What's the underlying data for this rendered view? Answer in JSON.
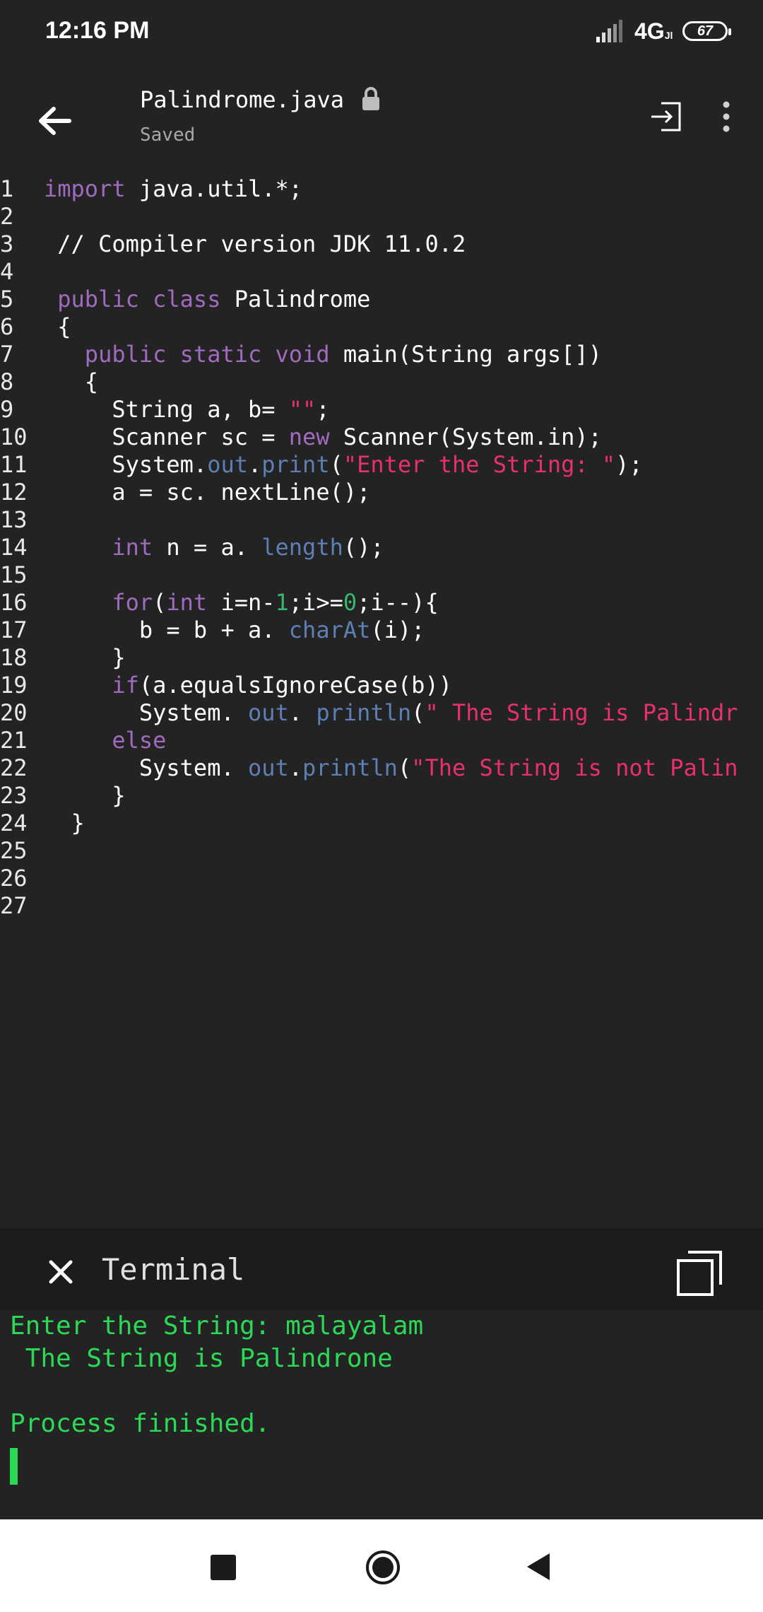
{
  "status_bar": {
    "time": "12:16 PM",
    "network": "4G",
    "network_sub": "Jl",
    "battery": "67"
  },
  "app_bar": {
    "title": "Palindrome.java",
    "subtitle": "Saved",
    "icons": [
      "back-arrow-icon",
      "lock-icon",
      "run-icon",
      "more-vert-icon"
    ]
  },
  "editor": {
    "line_numbers": [
      "1",
      "2",
      "3",
      "4",
      "5",
      "6",
      "7",
      "8",
      "9",
      "10",
      "11",
      "12",
      "13",
      "14",
      "15",
      "16",
      "17",
      "18",
      "19",
      "20",
      "21",
      "22",
      "23",
      "24",
      "25",
      "26",
      "27"
    ],
    "lines": [
      [
        {
          "t": "import",
          "c": "kw"
        },
        {
          "t": " java.util.*;"
        }
      ],
      [],
      [
        {
          "t": " // Compiler version JDK 11.0.2"
        }
      ],
      [],
      [
        {
          "t": " "
        },
        {
          "t": "public class",
          "c": "kw"
        },
        {
          "t": " Palindrome"
        }
      ],
      [
        {
          "t": " {"
        }
      ],
      [
        {
          "t": "   "
        },
        {
          "t": "public static void",
          "c": "kw"
        },
        {
          "t": " main(String args[])"
        }
      ],
      [
        {
          "t": "   {"
        }
      ],
      [
        {
          "t": "     String a, b= "
        },
        {
          "t": "\"\"",
          "c": "str"
        },
        {
          "t": ";"
        }
      ],
      [
        {
          "t": "     Scanner sc = "
        },
        {
          "t": "new",
          "c": "kw"
        },
        {
          "t": " Scanner(System.in);"
        }
      ],
      [
        {
          "t": "     System."
        },
        {
          "t": "out",
          "c": "fn"
        },
        {
          "t": "."
        },
        {
          "t": "print",
          "c": "fn"
        },
        {
          "t": "("
        },
        {
          "t": "\"Enter the String: \"",
          "c": "str"
        },
        {
          "t": ");"
        }
      ],
      [
        {
          "t": "     a = sc. nextLine();"
        }
      ],
      [],
      [
        {
          "t": "     "
        },
        {
          "t": "int",
          "c": "kw"
        },
        {
          "t": " n = a. "
        },
        {
          "t": "length",
          "c": "fn"
        },
        {
          "t": "();"
        }
      ],
      [],
      [
        {
          "t": "     "
        },
        {
          "t": "for",
          "c": "kw"
        },
        {
          "t": "("
        },
        {
          "t": "int",
          "c": "kw"
        },
        {
          "t": " i=n-"
        },
        {
          "t": "1",
          "c": "num"
        },
        {
          "t": ";i>="
        },
        {
          "t": "0",
          "c": "num"
        },
        {
          "t": ";i--){"
        }
      ],
      [
        {
          "t": "       b = b + a. "
        },
        {
          "t": "charAt",
          "c": "fn"
        },
        {
          "t": "(i);"
        }
      ],
      [
        {
          "t": "     }"
        }
      ],
      [
        {
          "t": "     "
        },
        {
          "t": "if",
          "c": "kw"
        },
        {
          "t": "(a.equalsIgnoreCase(b))"
        }
      ],
      [
        {
          "t": "       System. "
        },
        {
          "t": "out",
          "c": "fn"
        },
        {
          "t": ". "
        },
        {
          "t": "println",
          "c": "fn"
        },
        {
          "t": "("
        },
        {
          "t": "\" The String is Palindr",
          "c": "str"
        }
      ],
      [
        {
          "t": "     "
        },
        {
          "t": "else",
          "c": "kw"
        }
      ],
      [
        {
          "t": "       System. "
        },
        {
          "t": "out",
          "c": "fn"
        },
        {
          "t": "."
        },
        {
          "t": "println",
          "c": "fn"
        },
        {
          "t": "("
        },
        {
          "t": "\"The String is not Palin",
          "c": "str"
        }
      ],
      [
        {
          "t": "     }"
        }
      ],
      [
        {
          "t": "  }"
        }
      ],
      [],
      [],
      []
    ]
  },
  "terminal": {
    "title": "Terminal",
    "output": [
      "Enter the String: malayalam",
      " The String is Palindrone",
      "",
      "Process finished."
    ]
  },
  "nav_bar": {
    "icons": [
      "recents-square-icon",
      "home-circle-icon",
      "back-triangle-icon"
    ]
  }
}
